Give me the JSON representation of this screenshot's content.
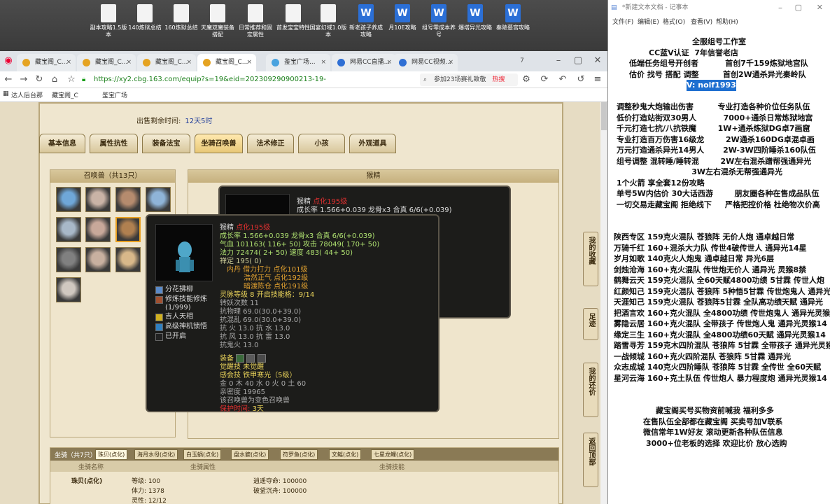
{
  "desktop_icons": [
    {
      "label": "副本攻略1.5版本",
      "type": "doc"
    },
    {
      "label": "140炼狱总结",
      "type": "doc"
    },
    {
      "label": "160炼狱总结",
      "type": "doc"
    },
    {
      "label": "天魔双魔装备搭配",
      "type": "doc"
    },
    {
      "label": "日常推荐和固定属性",
      "type": "doc"
    },
    {
      "label": "首发宝宝特性",
      "type": "doc"
    },
    {
      "label": "国宴幻域1.0版本",
      "type": "doc"
    },
    {
      "label": "新老孩子养成攻略",
      "type": "word"
    },
    {
      "label": "月10E攻略",
      "type": "word"
    },
    {
      "label": "组号零成本养号",
      "type": "word"
    },
    {
      "label": "爆塔异光攻略",
      "type": "word"
    },
    {
      "label": "秦陵墓宫攻略",
      "type": "word"
    }
  ],
  "browser": {
    "tabs": [
      "藏宝阁_C...",
      "藏宝阁_C...",
      "藏宝阁_C...",
      "藏宝阁_C...",
      "鉴宝广场...",
      "网易CC直播...",
      "网易CC视频..."
    ],
    "url": "https://xy2.cbg.163.com/equip?s=19&eid=202309290900213-19-CTJ0U1ZRREFFW&o&v",
    "search_text": "参加23场赛礼致敬",
    "hot_label": "热搜",
    "bookmarks": [
      "达人后台那",
      "藏宝阁_C",
      "鉴宝广场"
    ]
  },
  "page": {
    "sell_time_label": "出售剩余时间:",
    "sell_time_value": "12天5时",
    "tabs": [
      "基本信息",
      "属性抗性",
      "装备法宝",
      "坐骑召唤兽",
      "法术修正",
      "小孩",
      "外观道具"
    ],
    "summon_title": "召唤兽（共13只）",
    "right_title": "猴精",
    "side_buttons": [
      "我的收藏",
      "足迹",
      "我的还价",
      "返回顶部"
    ]
  },
  "back_panel": {
    "line1_name": "猴精",
    "line1_tag": "点化195级",
    "line2": "成长率 1.566+0.039 龙骨x3 合真 6/6(+0.039)"
  },
  "tooltip": {
    "name": "猴精",
    "tag": "点化195级",
    "growth": "成长率 1.566+0.039 龙骨x3 合真 6/6(+0.039)",
    "hp": "气血 101163( 116+ 50) 攻击 78049( 170+ 50)",
    "mp": "法力 72474( 2+ 50) 速度 483( 44+ 50)",
    "potential": "禅定 195( 0)",
    "attrs": [
      "内丹 借力打力 点化101级",
      "浩然正气 点化192级",
      "暗渡陈仓 点化191级"
    ],
    "skills": [
      "分花拂柳",
      "修炼技能修炼 (1/999)",
      "吉人天相",
      "高级神机锁悟",
      "已开启"
    ],
    "spirit": "灵脉等级  8 开启技能格：9/14",
    "rebirth": "转妖次数 11",
    "resist": [
      "抗物理 69.0(30.0+39.0)",
      "抗混乱 69.0(30.0+39.0)",
      "抗  火  13.0 抗  水  13.0",
      "抗  风  13.0 抗  雷  13.0",
      "抗鬼火 13.0"
    ],
    "equip_label": "装备",
    "awaken": "觉醒技  未觉醒",
    "sense": "感会技  铁甲寒光（5级）",
    "elements": "金 0 木 40 水 0 火 0 土 60",
    "intimacy": "亲密度 19965",
    "summon_note": "该召唤兽为变色召唤兽",
    "protect_label": "保护时间:",
    "protect_value": "3天"
  },
  "mounts": {
    "title": "坐骑（共7只）",
    "tabs": [
      "珠贝(点化)",
      "海月水母(点化)",
      "白玉蜗(点化)",
      "盘水貔(点化)",
      "符罗鱼(点化)",
      "文鳐(点化)",
      "七星龙鲤(点化)"
    ],
    "header_left": "坐骑名称",
    "header_mid": "坐骑属性",
    "header_right": "坐骑技能",
    "name": "珠贝(点化)",
    "stats": [
      "等级: 100",
      "体力: 1378",
      "灵性: 12/12"
    ],
    "skills": [
      "逍遥夺命: 100000",
      "破釜沉舟: 100000"
    ]
  },
  "notepad": {
    "title": "*新建文本文档 - 记事本",
    "menu": [
      "文件(F)",
      "编辑(E)",
      "格式(O)",
      "查看(V)",
      "帮助(H)"
    ],
    "lines": [
      "全服组号工作室",
      "CC蓝V认证  7年信誉老店",
      "低端任务组号开创者          首创7千159炼狱地宫队",
      "估价 找号 搭配 调整         首创2W通杀异光秦岭队",
      "V: noif1993",
      "",
      "调整秒鬼大炮输出伤害         专业打造各种价位任务队伍",
      "低价打造站街双30男人          7000+通杀日常炼狱地宫",
      "千元打造七抗/八抗铁魔        1W+通杀炼狱DG卓7画窟",
      "专业打造百万伤害16级龙        2W通杀160DG卓混卓画",
      "万元打造通杀异光14男人       2W-3W四阶睡杀160队伍",
      "组号调整 混转睡/睡转混        2W左右混杀蹭帮强通异光",
      "                            3W左右混杀无帮强通异光",
      "1个火箭 享全套12份攻略",
      "单号5W内估价 30大话西游        朋友圈各种在售成品队伍",
      "一切交易走藏宝阁 拒绝线下     严格把控价格 杜绝物次价高",
      "",
      "",
      "陕西专区 159克火混队 苍狼阵 无价人炮 通卓越日常",
      "万骑千红 160+混杀大力队 传世4破传世人 通异光14星",
      "岁月如歌 140克火人炮鬼 通卓越日常 异光6层",
      "剑烛沧海 160+克火混队 传世炮无价人 通异光 灵猴8禁",
      "鹤舞云天 159克火混队 全60天赋4800功绩 5甘霖 传世人炮",
      "红颜知己 159克火混队 苍狼阵 5种悟5甘霖 传世炮鬼人 通异光",
      "天涯知己 159克火混队 苍狼阵5甘霖 全队高功绩天赋 通异光",
      "把酒言欢 160+克火混队 全4800功绩 传世炮鬼人 通异光灵猴",
      "雾隐云居 160+克火混队 全带孩子 传世炮人鬼 通异光灵猴14",
      "缘定三生 160+克火混队 全4800功绩60天赋 通异光灵猴14",
      "踏雪寻芳 159克木四阶混队 苍狼阵 5甘霖 全带孩子 通异光灵猴",
      "一战倾城 160+克火四阶混队 苍狼阵 5甘霖 通异光",
      "众志成城 140克火四阶睡队 苍狼阵 5甘霖 全传世 全60天赋",
      "星河云海 160+克土队伍 传世炮人 暴力程度炮 通异光灵猴14",
      "",
      "",
      "藏宝阁买号买物资前喊我 福利多多",
      "在售队伍全部都在藏宝阁 买卖号加V联系",
      "微信常年1W好友 滚动更新各种队伍信息",
      "3000+位老板的选择 欢迎比价 放心选购"
    ]
  }
}
